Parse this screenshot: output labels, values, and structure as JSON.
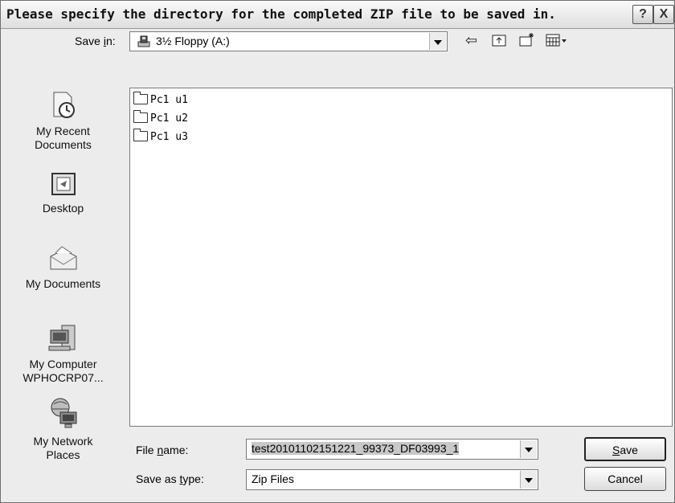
{
  "window": {
    "title": "Please specify the directory for the completed ZIP file to be saved in.",
    "help_label": "?",
    "close_label": "X"
  },
  "save_in": {
    "label_pre": "Save ",
    "label_u": "i",
    "label_post": "n:",
    "value": "3½ Floppy (A:)"
  },
  "toolbar": {
    "back_icon": "back-arrow-icon",
    "up_icon": "up-folder-icon",
    "new_folder_icon": "new-folder-icon",
    "views_icon": "views-menu-icon"
  },
  "places": [
    {
      "line1": "My Recent",
      "line2": "Documents",
      "icon": "recent-documents-icon"
    },
    {
      "line1": "Desktop",
      "line2": "",
      "icon": "desktop-icon"
    },
    {
      "line1": "My Documents",
      "line2": "",
      "icon": "my-documents-icon"
    },
    {
      "line1": "My Computer",
      "line2": "WPHOCRP07...",
      "icon": "my-computer-icon"
    },
    {
      "line1": "My Network",
      "line2": "Places",
      "icon": "network-places-icon"
    }
  ],
  "files": [
    {
      "name": "Pc1 u1"
    },
    {
      "name": "Pc1 u2"
    },
    {
      "name": "Pc1 u3"
    }
  ],
  "file_name": {
    "label_pre": "File ",
    "label_u": "n",
    "label_post": "ame:",
    "value": "test20101102151221_99373_DF03993_1"
  },
  "save_as_type": {
    "label_pre": "Save as ",
    "label_u": "t",
    "label_post": "ype:",
    "value": "Zip Files"
  },
  "buttons": {
    "save_u": "S",
    "save_rest": "ave",
    "cancel": "Cancel"
  }
}
